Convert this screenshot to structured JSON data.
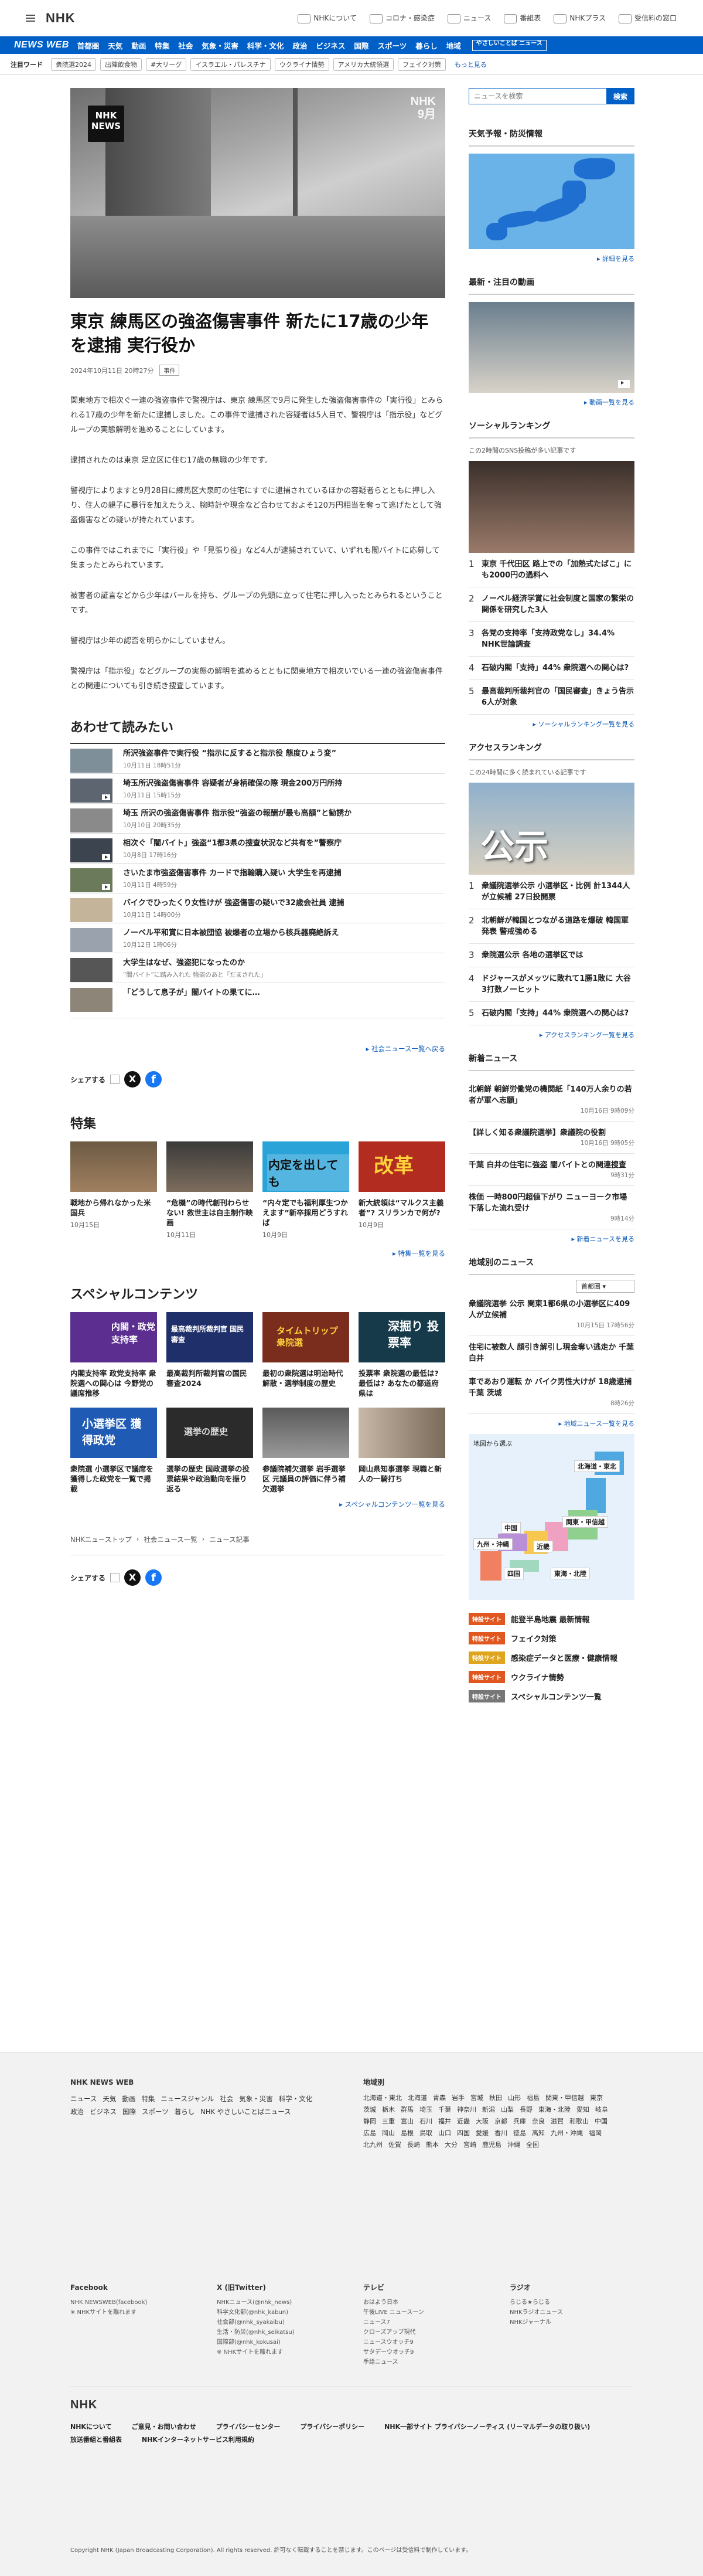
{
  "header": {
    "logo": "NHK",
    "links": [
      "NHKについて",
      "コロナ・感染症",
      "ニュース",
      "番組表",
      "NHKプラス",
      "受信料の窓口"
    ]
  },
  "nav": {
    "brand": "NEWS WEB",
    "items": [
      "首都圏",
      "天気",
      "動画",
      "特集",
      "社会",
      "気象・災害",
      "科学・文化",
      "政治",
      "ビジネス",
      "国際",
      "スポーツ",
      "暮らし",
      "地域"
    ],
    "easy": "やさしいことば ニュース"
  },
  "keywords": {
    "label": "注目ワード",
    "items": [
      "衆院選2024",
      "出陣飲食物",
      "#大リーグ",
      "イスラエル・パレスチナ",
      "ウクライナ情勢",
      "アメリカ大統領選",
      "フェイク対策"
    ],
    "more": "もっと見る"
  },
  "article": {
    "badge": "NHK NEWS",
    "watermark_top": "NHK",
    "watermark_bottom": "9月",
    "title": "東京 練馬区の強盗傷害事件 新たに17歳の少年を逮捕 実行役か",
    "date": "2024年10月11日 20時27分",
    "tag": "事件",
    "paragraphs": [
      "関東地方で相次ぐ一連の強盗事件で警視庁は、東京 練馬区で9月に発生した強盗傷害事件の「実行役」とみられる17歳の少年を新たに逮捕しました。この事件で逮捕された容疑者は5人目で、警視庁は「指示役」などグループの実態解明を進めることにしています。",
      "逮捕されたのは東京 足立区に住む17歳の無職の少年です。",
      "警視庁によりますと9月28日に練馬区大泉町の住宅にすでに逮捕されているほかの容疑者らとともに押し入り、住人の親子に暴行を加えたうえ、腕時計や現金など合わせておよそ120万円相当を奪って逃げたとして強盗傷害などの疑いが持たれています。",
      "この事件ではこれまでに「実行役」や「見張り役」など4人が逮捕されていて、いずれも闇バイトに応募して集まったとみられています。",
      "被害者の証言などから少年はバールを持ち、グループの先頭に立って住宅に押し入ったとみられるということです。",
      "警視庁は少年の認否を明らかにしていません。",
      "警視庁は「指示役」などグループの実態の解明を進めるとともに関東地方で相次いでいる一連の強盗傷害事件との関連についても引き続き捜査しています。"
    ]
  },
  "related": {
    "heading": "あわせて読みたい",
    "items": [
      {
        "title": "所沢強盗事件で実行役 “指示に反すると指示役 態度ひょう変”",
        "date": "10月11日 18時51分",
        "video": false
      },
      {
        "title": "埼玉所沢強盗傷害事件 容疑者が身柄確保の際 現金200万円所持",
        "date": "10月11日 15時15分",
        "video": true
      },
      {
        "title": "埼玉 所沢の強盗傷害事件 指示役“強盗の報酬が最も高額”と勧誘か",
        "date": "10月10日 20時35分",
        "video": false
      },
      {
        "title": "相次ぐ「闇バイト」強盗“1都3県の捜査状況など共有を”警察庁",
        "date": "10月8日 17時16分",
        "video": true
      },
      {
        "title": "さいたま市強盗傷害事件 カードで指輪購入疑い 大学生を再逮捕",
        "date": "10月11日 4時59分",
        "video": true
      },
      {
        "title": "バイクでひったくり女性けが 強盗傷害の疑いで32歳会社員 逮捕",
        "date": "10月11日 14時00分",
        "video": false
      },
      {
        "title": "ノーベル平和賞に日本被団協 被爆者の立場から核兵器廃絶訴え",
        "date": "10月12日 1時06分",
        "video": false
      },
      {
        "title": "大学生はなぜ、強盗犯になったのか",
        "subtitle": "“闇バイト”に踏み入れた 強盗のあと「だまされた」",
        "date": "",
        "video": false
      },
      {
        "title": "「どうして息子が」闇バイトの果てに…",
        "date": "",
        "video": false
      }
    ],
    "more": "社会ニュース一覧へ戻る"
  },
  "share": {
    "label": "シェアする"
  },
  "features": {
    "heading": "特集",
    "items": [
      {
        "title": "戦地から帰れなかった米国兵",
        "date": "10月15日",
        "img_text": ""
      },
      {
        "title": "“危機”の時代創刊わらせない! 救世主は自主制作映画",
        "date": "10月11日",
        "img_text": ""
      },
      {
        "title": "“内々定でも福利厚生つかえます”新卒採用どうすれば",
        "date": "10月9日",
        "img_text": "内定を出しても"
      },
      {
        "title": "新大統領は“マルクス主義者”? スリランカで何が?",
        "date": "10月9日",
        "img_text": "改革"
      }
    ],
    "more": "特集一覧を見る"
  },
  "special": {
    "heading": "スペシャルコンテンツ",
    "items": [
      {
        "title": "内閣支持率 政党支持率 衆院選への関心は 今野党の議席推移",
        "img_text": "内閣・政党 支持率"
      },
      {
        "title": "最高裁判所裁判官の国民審査2024",
        "img_text": "最高裁判所裁判官 国民審査"
      },
      {
        "title": "最初の衆院選は明治時代 解散・選挙制度の歴史",
        "img_text": "タイムトリップ 衆院選"
      },
      {
        "title": "投票率 衆院選の最低は? 最低は? あなたの都道府県は",
        "img_text": "深掘り 投票率"
      },
      {
        "title": "衆院選 小選挙区で議席を獲得した政党を一覧で掲載",
        "img_text": "小選挙区 獲得政党"
      },
      {
        "title": "選挙の歴史 国政選挙の投票結果や政治動向を振り返る",
        "img_text": "選挙の歴史"
      },
      {
        "title": "参議院補欠選挙 岩手選挙区 元議員の評価に伴う補欠選挙",
        "img_text": ""
      },
      {
        "title": "岡山県知事選挙 現職と新人の一騎打ち",
        "img_text": ""
      }
    ],
    "more": "スペシャルコンテンツ一覧を見る"
  },
  "breadcrumb": [
    "NHKニューストップ",
    "社会ニュース一覧",
    "ニュース記事"
  ],
  "sidebar": {
    "search_placeholder": "ニュースを検索",
    "search_button": "検索",
    "weather": {
      "heading": "天気予報・防災情報",
      "more": "詳細を見る"
    },
    "video": {
      "heading": "最新・注目の動画",
      "more": "動画一覧を見る"
    },
    "social": {
      "heading": "ソーシャルランキング",
      "sub": "この2時間のSNS投稿が多い記事です",
      "items": [
        "東京 千代田区 路上での「加熱式たばこ」にも2000円の過料へ",
        "ノーベル経済学賞に社会制度と国家の繁栄の関係を研究した3人",
        "各党の支持率「支持政党なし」34.4% NHK世論調査",
        "石破内閣「支持」44% 衆院選への関心は?",
        "最高裁判所裁判官の「国民審査」きょう告示 6人が対象"
      ],
      "more": "ソーシャルランキング一覧を見る"
    },
    "access": {
      "heading": "アクセスランキング",
      "sub": "この24時間に多く読まれている記事です",
      "img_text": "公示",
      "items": [
        "衆議院選挙公示 小選挙区・比例 計1344人が立候補 27日投開票",
        "北朝鮮が韓国とつながる道路を爆破 韓国軍発表 警戒強める",
        "衆院選公示 各地の選挙区では",
        "ドジャースがメッツに敗れて1勝1敗に 大谷3打数ノーヒット",
        "石破内閣「支持」44% 衆院選への関心は?"
      ],
      "more": "アクセスランキング一覧を見る"
    },
    "latest": {
      "heading": "新着ニュース",
      "items": [
        {
          "title": "北朝鮮 朝鮮労働党の機関紙「140万人余りの若者が軍へ志願」",
          "date": "10月16日 9時09分"
        },
        {
          "title": "【詳しく知る衆議院選挙】衆議院の役割",
          "date": "10月16日 9時05分"
        },
        {
          "title": "千葉 白井の住宅に強盗 闇バイトとの関連捜査",
          "date": "9時31分"
        },
        {
          "title": "株価 一時800円超値下がり ニューヨーク市場下落した流れ受け",
          "date": "9時14分"
        }
      ],
      "more": "新着ニュースを見る"
    },
    "region": {
      "heading": "地域別のニュース",
      "select": "首都圏",
      "items": [
        {
          "title": "衆議院選挙 公示 関東1都6県の小選挙区に409人が立候補",
          "date": "10月15日 17時56分"
        },
        {
          "title": "住宅に被数人 顔引き解引し現金奪い逃走か 千葉 白井",
          "date": ""
        },
        {
          "title": "車であおり運転 か バイク男性大けが 18歳逮捕 千葉 茨城",
          "date": "8時26分"
        }
      ],
      "more": "地域ニュース一覧を見る",
      "map_label": "地図から選ぶ",
      "regions": [
        "北海道・東北",
        "関東・甲信越",
        "中国",
        "近畿",
        "九州・沖縄",
        "四国",
        "東海・北陸"
      ]
    },
    "specials": [
      {
        "badge": "特設サイト",
        "label": "能登半島地震 最新情報",
        "color": "#e0571f"
      },
      {
        "badge": "特設サイト",
        "label": "フェイク対策",
        "color": "#e0571f"
      },
      {
        "badge": "特設サイト",
        "label": "感染症データと医療・健康情報",
        "color": "#e0a51f"
      },
      {
        "badge": "特設サイト",
        "label": "ウクライナ情勢",
        "color": "#e0571f"
      },
      {
        "badge": "特設サイト",
        "label": "スペシャルコンテンツ一覧",
        "color": "#777777"
      }
    ]
  },
  "footer": {
    "brand": "NHK NEWS WEB",
    "col1": [
      "ニュース",
      "天気",
      "動画",
      "特集",
      "ニュースジャンル",
      "社会",
      "気象・災害",
      "科学・文化",
      "政治",
      "ビジネス",
      "国際",
      "スポーツ",
      "暮らし",
      "NHK やさしいことばニュース"
    ],
    "region_head": "地域別",
    "regions": [
      "北海道・東北",
      "北海道",
      "青森",
      "岩手",
      "宮城",
      "秋田",
      "山形",
      "福島",
      "関東・甲信越",
      "東京",
      "茨城",
      "栃木",
      "群馬",
      "埼玉",
      "千葉",
      "神奈川",
      "新潟",
      "山梨",
      "長野",
      "東海・北陸",
      "愛知",
      "岐阜",
      "静岡",
      "三重",
      "富山",
      "石川",
      "福井",
      "近畿",
      "大阪",
      "京都",
      "兵庫",
      "奈良",
      "滋賀",
      "和歌山",
      "中国",
      "広島",
      "岡山",
      "島根",
      "鳥取",
      "山口",
      "四国",
      "愛媛",
      "香川",
      "徳島",
      "高知",
      "九州・沖縄",
      "福岡",
      "北九州",
      "佐賀",
      "長崎",
      "熊本",
      "大分",
      "宮崎",
      "鹿児島",
      "沖縄",
      "全国"
    ],
    "sns_head": "Facebook",
    "sns": [
      "NHK NEWSWEB(facebook)",
      "※ NHKサイトを離れます"
    ],
    "x_head": "X (旧Twitter)",
    "x": [
      "NHKニュース(@nhk_news)",
      "科学文化部(@nhk_kabun)",
      "社会部(@nhk_syakaibu)",
      "生活・防災(@nhk_seikatsu)",
      "国際部(@nhk_kokusai)",
      "※ NHKサイトを離れます"
    ],
    "tv_head": "テレビ",
    "tv": [
      "おはよう日本",
      "午後LIVE ニュースーン",
      "ニュース7",
      "クローズアップ現代",
      "ニュースウオッチ9",
      "サタデーウオッチ9",
      "手話ニュース"
    ],
    "radio_head": "ラジオ",
    "radio": [
      "らじる★らじる",
      "NHKラジオニュース",
      "NHKジャーナル"
    ],
    "bottom_logo": "NHK",
    "bottom_links": [
      "NHKについて",
      "ご意見・お問い合わせ",
      "プライバシーセンター",
      "プライバシーポリシー",
      "NHK一部サイト プライバシーノーティス (リーマルデータの取り扱い)",
      "放送番組と番組表",
      "NHKインターネットサービス利用規約"
    ],
    "copyright": "Copyright NHK (Japan Broadcasting Corporation). All rights reserved. 許可なく転載することを禁じます。このページは受信料で制作しています。"
  }
}
